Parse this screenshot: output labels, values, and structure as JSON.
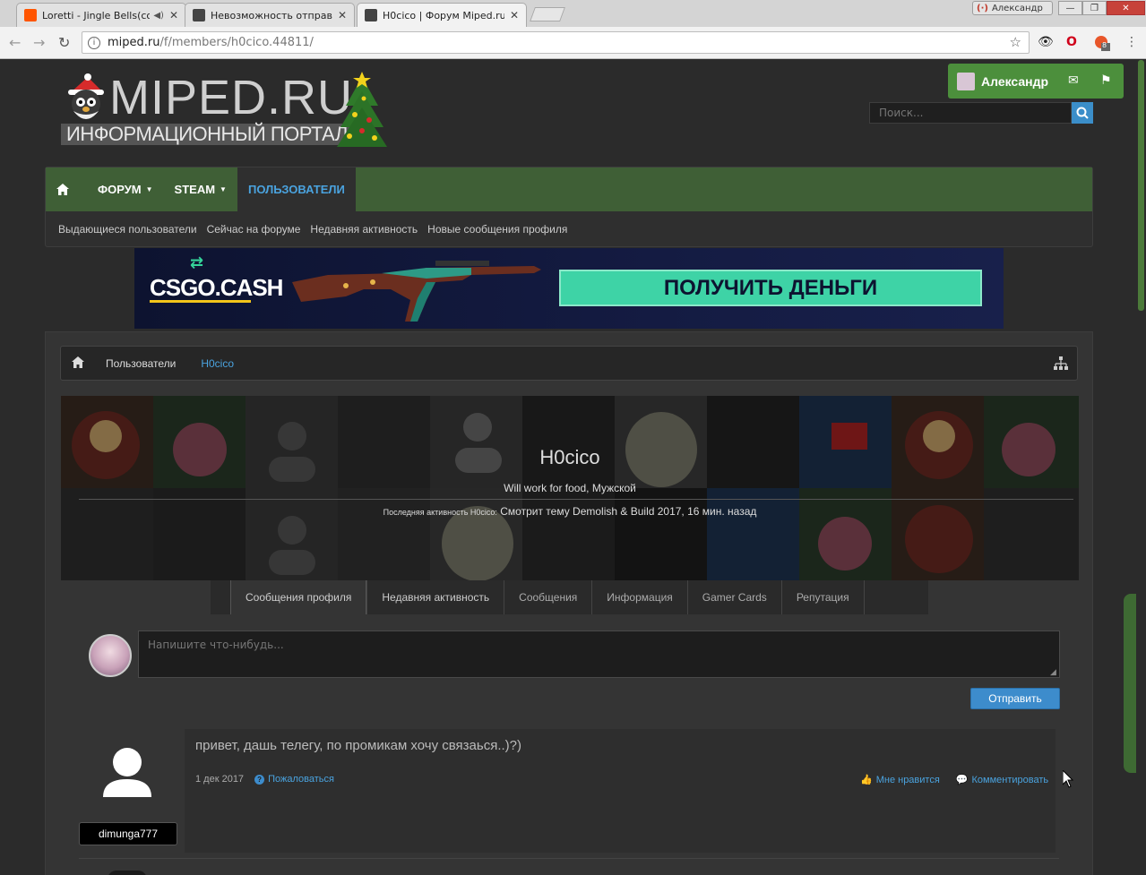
{
  "browser": {
    "tabs": [
      {
        "title": "Loretti - Jingle Bells(cov",
        "favicon_color": "#ff5500",
        "muted_icon": "speaker-icon"
      },
      {
        "title": "Невозможность отправки",
        "favicon_color": "#444444"
      },
      {
        "title": "H0cico | Форум Miped.ru",
        "favicon_color": "#444444",
        "active": true
      }
    ],
    "profile_chip": "Александр",
    "url_host": "miped.ru",
    "url_path": "/f/members/h0cico.44811/",
    "extension_badge": "8"
  },
  "site": {
    "logo_title": "MIPED.RU",
    "logo_subtitle": "ИНФОРМАЦИОННЫЙ ПОРТАЛ",
    "user_name": "Александр",
    "search_placeholder": "Поиск...",
    "accent": "#4aa3df",
    "nav_green": "#3f5f36"
  },
  "nav": {
    "items": [
      {
        "label": "ФОРУМ",
        "dropdown": true
      },
      {
        "label": "STEAM",
        "dropdown": true
      },
      {
        "label": "ПОЛЬЗОВАТЕЛИ",
        "active": true
      }
    ],
    "sub": [
      "Выдающиеся пользователи",
      "Сейчас на форуме",
      "Недавняя активность",
      "Новые сообщения профиля"
    ]
  },
  "banner": {
    "brand": "CSGO.CASH",
    "cta": "ПОЛУЧИТЬ ДЕНЬГИ"
  },
  "breadcrumb": {
    "items": [
      "Пользователи"
    ],
    "current": "H0cico"
  },
  "profile": {
    "username": "H0cico",
    "tagline": "Will work for food, Мужской",
    "activity_label": "Последняя активность H0cico:",
    "activity_value": "Смотрит тему Demolish & Build 2017, 16 мин. назад"
  },
  "tabs": [
    "Сообщения профиля",
    "Недавняя активность",
    "Сообщения",
    "Информация",
    "Gamer Cards",
    "Репутация"
  ],
  "composer": {
    "placeholder": "Напишите что-нибудь...",
    "submit_label": "Отправить"
  },
  "message": {
    "author": "dimunga777",
    "text": "привет, дашь телегу, по промикам хочу связаься..)?)",
    "date": "1 дек 2017",
    "report_label": "Пожаловаться",
    "like_label": "Мне нравится",
    "comment_label": "Комментировать"
  }
}
